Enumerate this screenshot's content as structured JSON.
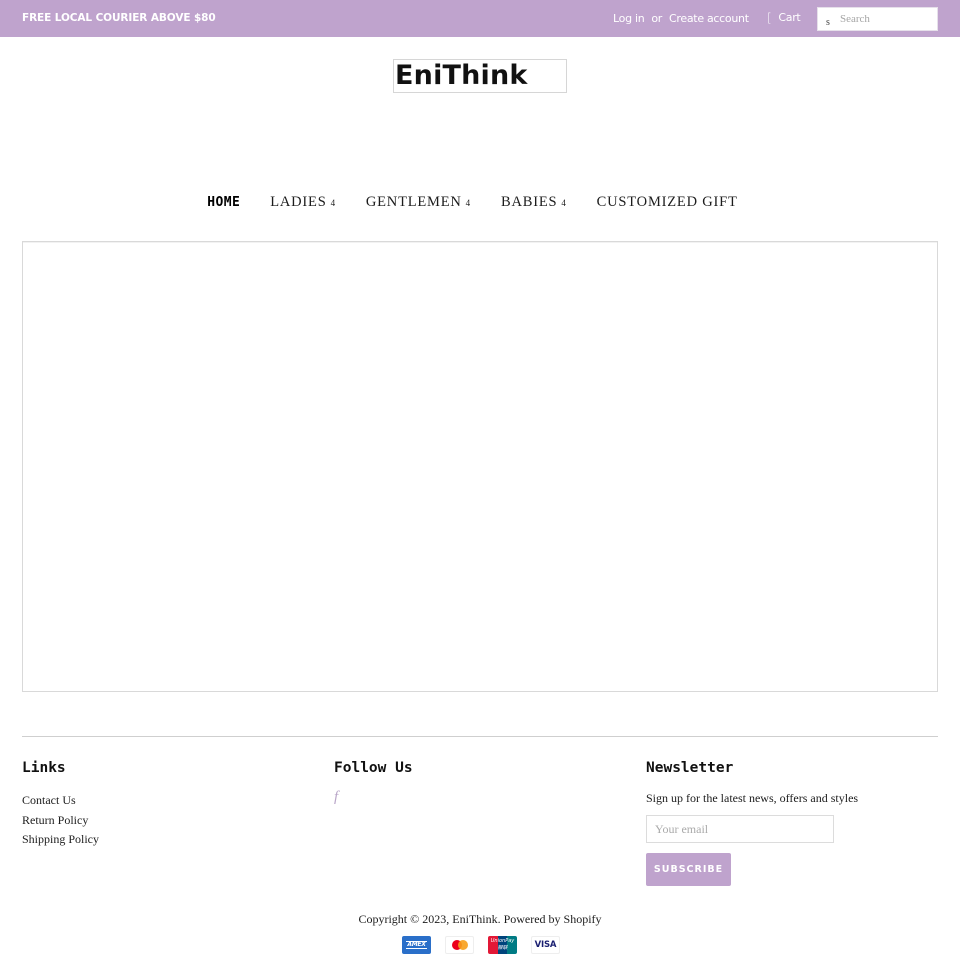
{
  "colors": {
    "accent": "#bfa3cd",
    "text": "#1c1c1c",
    "border": "#d9d9d9",
    "facebook_icon": "#b9a6c8"
  },
  "topbar": {
    "promo": "FREE LOCAL COURIER ABOVE $80",
    "login": "Log in",
    "or": "or",
    "create_account": "Create account",
    "cart_icon": "[",
    "cart_label": "Cart",
    "search_icon": "s",
    "search_placeholder": "Search",
    "search_value": ""
  },
  "logo": {
    "text": "EniThink"
  },
  "nav": {
    "items": [
      {
        "label": "HOME",
        "active": true,
        "dropdown": false
      },
      {
        "label": "LADIES",
        "chevron": "4",
        "dropdown": true
      },
      {
        "label": "GENTLEMEN",
        "chevron": "4",
        "dropdown": true
      },
      {
        "label": "BABIES",
        "chevron": "4",
        "dropdown": true
      },
      {
        "label": "CUSTOMIZED GIFT",
        "dropdown": false
      }
    ]
  },
  "footer": {
    "links": {
      "title": "Links",
      "items": [
        "Contact Us",
        "Return Policy",
        "Shipping Policy"
      ]
    },
    "follow": {
      "title": "Follow Us",
      "facebook_icon": "f"
    },
    "newsletter": {
      "title": "Newsletter",
      "text": "Sign up for the latest news, offers and styles",
      "email_placeholder": "Your email",
      "email_value": "",
      "button": "SUBSCRIBE"
    },
    "copyright": {
      "prefix": "Copyright © 2023, ",
      "brand": "EniThink",
      "separator": ". ",
      "powered": "Powered by Shopify"
    },
    "payments": {
      "amex": "AMEX",
      "mastercard": "mastercard",
      "unionpay": "UnionPay 银联",
      "visa": "VISA"
    }
  }
}
